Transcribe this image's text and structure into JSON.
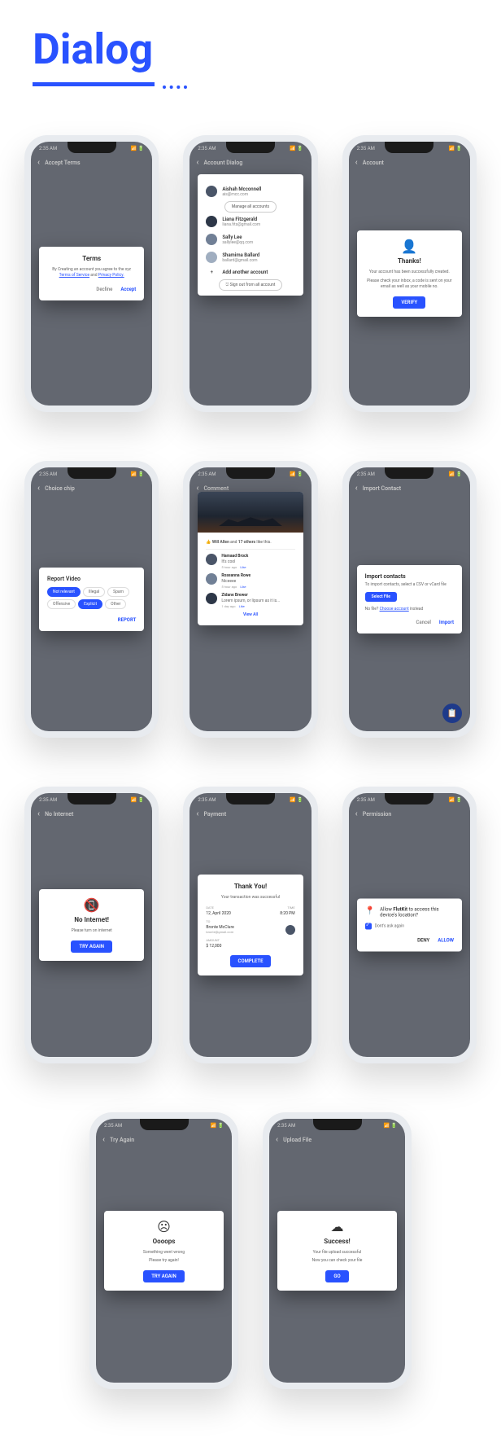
{
  "page_title": "Dialog",
  "status_time": "2:35 AM",
  "screens": {
    "terms": {
      "appbar": "Accept Terms",
      "title": "Terms",
      "body_pre": "By Creating an account you agree to the xyz ",
      "tos": "Terms of Service",
      "and": " and ",
      "privacy": "Privacy Policy.",
      "decline": "Decline",
      "accept": "Accept"
    },
    "account": {
      "appbar": "Account Dialog",
      "accounts": [
        {
          "name": "Aishah Mcconnell",
          "email": "ais@mcc.com"
        },
        {
          "name": "Liana Fitzgerald",
          "email": "liana.fits@gmail.com"
        },
        {
          "name": "Sally Lee",
          "email": "sallylee@qq.com"
        },
        {
          "name": "Shamima Ballard",
          "email": "ballard@gmail.com"
        }
      ],
      "manage": "Manage all accounts",
      "add": "Add another account",
      "signout": "Sign out from all account"
    },
    "thanks": {
      "appbar": "Account",
      "title": "Thanks!",
      "sub": "Your account has been successfully created.",
      "body": "Please check your inbox, a code is sent on your email as well as your mobile no.",
      "verify": "VERIFY"
    },
    "chip": {
      "appbar": "Choice chip",
      "title": "Report Video",
      "chips": [
        "Not relevant",
        "Illegal",
        "Spam",
        "Offensive",
        "Explicit",
        "Other"
      ],
      "report": "REPORT"
    },
    "comment": {
      "appbar": "Comment",
      "like_text": "Will Allen and 17 others like this.",
      "comments": [
        {
          "name": "Hamaad Brock",
          "text": "It's cool",
          "time": "5 hour ago"
        },
        {
          "name": "Roseanna Rowe",
          "text": "Niceeee",
          "time": "5 hour ago"
        },
        {
          "name": "Zidane Brewer",
          "text": "Lorem ipsum, or lipsum as it is...",
          "time": "1 day ago"
        }
      ],
      "like": "Like",
      "view_all": "View All"
    },
    "import": {
      "appbar": "Import Contact",
      "title": "Import contacts",
      "body": "To import contacts, select a CSV or vCard file",
      "select": "Select File",
      "nofile_pre": "No file? ",
      "nofile_link": "Choose account",
      "nofile_post": " instead",
      "cancel": "Cancel",
      "import_btn": "Import"
    },
    "nointernet": {
      "appbar": "No Internet",
      "title": "No Internet!",
      "body": "Please turn on internet",
      "try": "TRY AGAIN"
    },
    "payment": {
      "appbar": "Payment",
      "title": "Thank You!",
      "sub": "Your transaction was successful",
      "date_l": "DATE",
      "date_v": "12, April 2020",
      "time_l": "TIME",
      "time_v": "8:20 PM",
      "to_l": "TO",
      "to_name": "Bronte McClure",
      "to_email": "bronte@gmail.com",
      "amount_l": "AMOUNT",
      "amount_v": "$ 12,000",
      "complete": "COMPLETE"
    },
    "perm": {
      "appbar": "Permission",
      "body_pre": "Allow ",
      "body_app": "FlutKit",
      "body_post": " to access this device's location?",
      "dont": "Dont's ask again",
      "deny": "DENY",
      "allow": "ALLOW"
    },
    "tryagain": {
      "appbar": "Try Again",
      "title": "Oooops",
      "sub": "Something went wrong",
      "body": "Please try again!",
      "try": "TRY AGAIN"
    },
    "upload": {
      "appbar": "Upload File",
      "title": "Success!",
      "sub": "Your file upload successful",
      "body": "Now you can check your file",
      "go": "GO"
    }
  }
}
